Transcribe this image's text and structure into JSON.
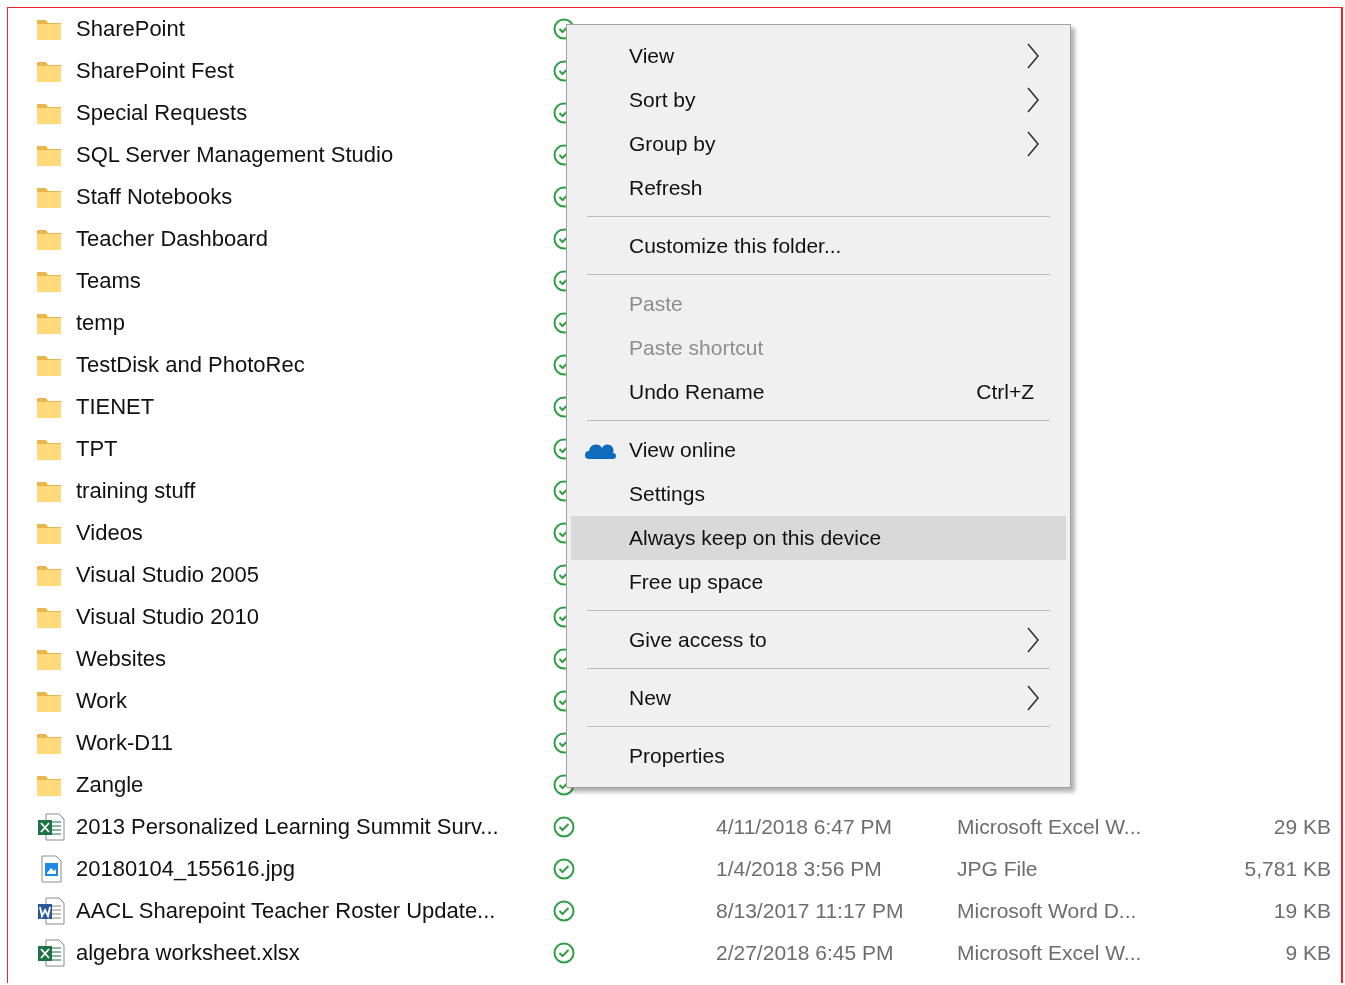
{
  "files": [
    {
      "name": "SharePoint",
      "kind": "folder"
    },
    {
      "name": "SharePoint Fest",
      "kind": "folder"
    },
    {
      "name": "Special Requests",
      "kind": "folder"
    },
    {
      "name": "SQL Server Management Studio",
      "kind": "folder"
    },
    {
      "name": "Staff Notebooks",
      "kind": "folder"
    },
    {
      "name": "Teacher Dashboard",
      "kind": "folder"
    },
    {
      "name": "Teams",
      "kind": "folder"
    },
    {
      "name": "temp",
      "kind": "folder"
    },
    {
      "name": "TestDisk and PhotoRec",
      "kind": "folder"
    },
    {
      "name": "TIENET",
      "kind": "folder"
    },
    {
      "name": "TPT",
      "kind": "folder"
    },
    {
      "name": "training stuff",
      "kind": "folder"
    },
    {
      "name": "Videos",
      "kind": "folder"
    },
    {
      "name": "Visual Studio 2005",
      "kind": "folder"
    },
    {
      "name": "Visual Studio 2010",
      "kind": "folder"
    },
    {
      "name": "Websites",
      "kind": "folder"
    },
    {
      "name": "Work",
      "kind": "folder"
    },
    {
      "name": "Work-D11",
      "kind": "folder"
    },
    {
      "name": "Zangle",
      "kind": "folder"
    },
    {
      "name": "2013 Personalized Learning Summit Surv...",
      "kind": "excel",
      "date": "4/11/2018 6:47 PM",
      "type": "Microsoft Excel W...",
      "size": "29 KB"
    },
    {
      "name": "20180104_155616.jpg",
      "kind": "image",
      "date": "1/4/2018 3:56 PM",
      "type": "JPG File",
      "size": "5,781 KB"
    },
    {
      "name": "AACL Sharepoint Teacher Roster Update...",
      "kind": "word",
      "date": "8/13/2017 11:17 PM",
      "type": "Microsoft Word D...",
      "size": "19 KB"
    },
    {
      "name": "algebra worksheet.xlsx",
      "kind": "excel",
      "date": "2/27/2018 6:45 PM",
      "type": "Microsoft Excel W...",
      "size": "9 KB"
    }
  ],
  "context_menu": [
    {
      "kind": "item",
      "label": "View",
      "submenu": true,
      "disabled": false,
      "selected": false
    },
    {
      "kind": "item",
      "label": "Sort by",
      "submenu": true,
      "disabled": false,
      "selected": false
    },
    {
      "kind": "item",
      "label": "Group by",
      "submenu": true,
      "disabled": false,
      "selected": false
    },
    {
      "kind": "item",
      "label": "Refresh",
      "submenu": false,
      "disabled": false,
      "selected": false
    },
    {
      "kind": "separator"
    },
    {
      "kind": "item",
      "label": "Customize this folder...",
      "submenu": false,
      "disabled": false,
      "selected": false
    },
    {
      "kind": "separator"
    },
    {
      "kind": "item",
      "label": "Paste",
      "submenu": false,
      "disabled": true,
      "selected": false
    },
    {
      "kind": "item",
      "label": "Paste shortcut",
      "submenu": false,
      "disabled": true,
      "selected": false
    },
    {
      "kind": "item",
      "label": "Undo Rename",
      "shortcut": "Ctrl+Z",
      "submenu": false,
      "disabled": false,
      "selected": false
    },
    {
      "kind": "separator"
    },
    {
      "kind": "cloud",
      "label": "View online",
      "submenu": false,
      "disabled": false,
      "selected": false
    },
    {
      "kind": "item",
      "label": "Settings",
      "submenu": false,
      "disabled": false,
      "selected": false
    },
    {
      "kind": "item",
      "label": "Always keep on this device",
      "submenu": false,
      "disabled": false,
      "selected": true
    },
    {
      "kind": "item",
      "label": "Free up space",
      "submenu": false,
      "disabled": false,
      "selected": false
    },
    {
      "kind": "separator"
    },
    {
      "kind": "item",
      "label": "Give access to",
      "submenu": true,
      "disabled": false,
      "selected": false
    },
    {
      "kind": "separator"
    },
    {
      "kind": "item",
      "label": "New",
      "submenu": true,
      "disabled": false,
      "selected": false
    },
    {
      "kind": "separator"
    },
    {
      "kind": "item",
      "label": "Properties",
      "submenu": false,
      "disabled": false,
      "selected": false
    }
  ]
}
